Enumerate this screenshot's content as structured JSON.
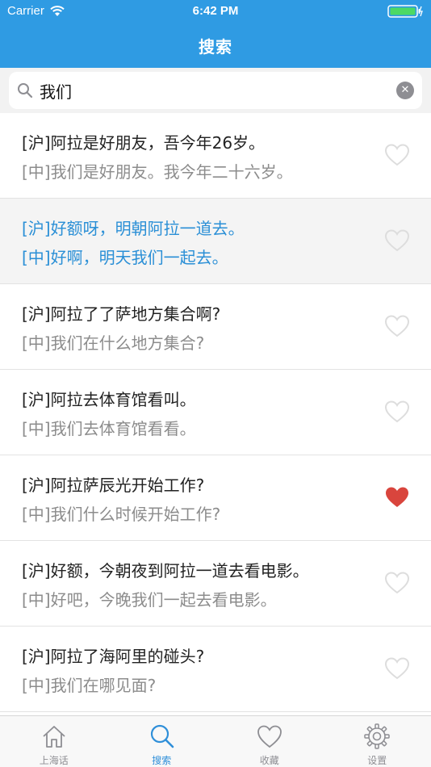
{
  "status_bar": {
    "carrier": "Carrier",
    "time": "6:42 PM"
  },
  "nav": {
    "title": "搜索"
  },
  "search": {
    "value": "我们",
    "placeholder": ""
  },
  "items": [
    {
      "hu": "[沪]阿拉是好朋友，吾今年26岁。",
      "zh": "[中]我们是好朋友。我今年二十六岁。",
      "favorited": false,
      "highlighted": false
    },
    {
      "hu": "[沪]好额呀，明朝阿拉一道去。",
      "zh": "[中]好啊，明天我们一起去。",
      "favorited": false,
      "highlighted": true
    },
    {
      "hu": "[沪]阿拉了了萨地方集合啊?",
      "zh": "[中]我们在什么地方集合?",
      "favorited": false,
      "highlighted": false
    },
    {
      "hu": "[沪]阿拉去体育馆看叫。",
      "zh": "[中]我们去体育馆看看。",
      "favorited": false,
      "highlighted": false
    },
    {
      "hu": "[沪]阿拉萨辰光开始工作?",
      "zh": "[中]我们什么时候开始工作?",
      "favorited": true,
      "highlighted": false
    },
    {
      "hu": "[沪]好额，今朝夜到阿拉一道去看电影。",
      "zh": "[中]好吧，今晚我们一起去看电影。",
      "favorited": false,
      "highlighted": false
    },
    {
      "hu": "[沪]阿拉了海阿里的碰头?",
      "zh": "[中]我们在哪见面?",
      "favorited": false,
      "highlighted": false
    }
  ],
  "tabs": [
    {
      "label": "上海话",
      "icon": "home-icon",
      "active": false
    },
    {
      "label": "搜索",
      "icon": "search-icon",
      "active": true
    },
    {
      "label": "收藏",
      "icon": "heart-icon",
      "active": false
    },
    {
      "label": "设置",
      "icon": "gear-icon",
      "active": false
    }
  ],
  "colors": {
    "nav_blue": "#2f9be3",
    "highlight_text": "#2a8fd6",
    "heart_filled": "#d9453d",
    "heart_outline": "#dddddd",
    "tab_active": "#2f8fd9",
    "tab_inactive": "#8e8e93"
  }
}
